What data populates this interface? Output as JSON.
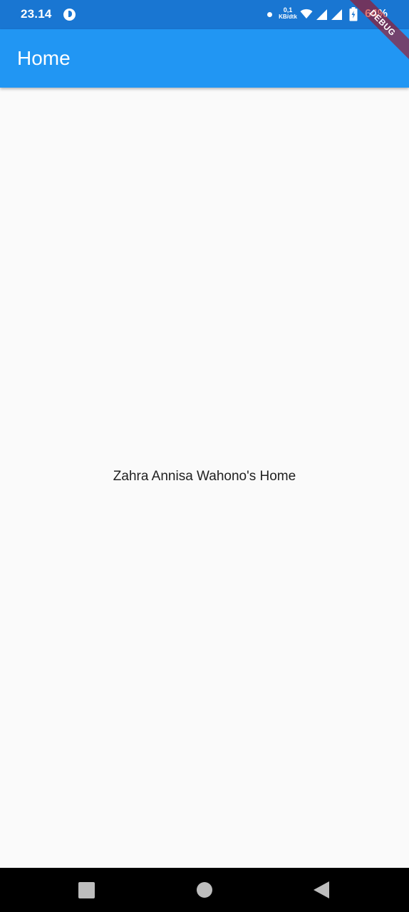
{
  "status_bar": {
    "time": "23.14",
    "speed_value": "0,1",
    "speed_unit": "KB/dtk",
    "battery": "64%"
  },
  "debug_banner": "DEBUG",
  "app_bar": {
    "title": "Home"
  },
  "body": {
    "text": "Zahra Annisa Wahono's Home"
  },
  "colors": {
    "status_bar": "#1976d2",
    "app_bar": "#2196f3",
    "background": "#fafafa",
    "nav_bar": "#000000"
  },
  "icons": {
    "status": [
      "app-icon",
      "dot-icon",
      "wifi-icon",
      "signal-icon",
      "signal-icon",
      "battery-icon"
    ],
    "nav": [
      "recents-icon",
      "home-icon",
      "back-icon"
    ]
  }
}
